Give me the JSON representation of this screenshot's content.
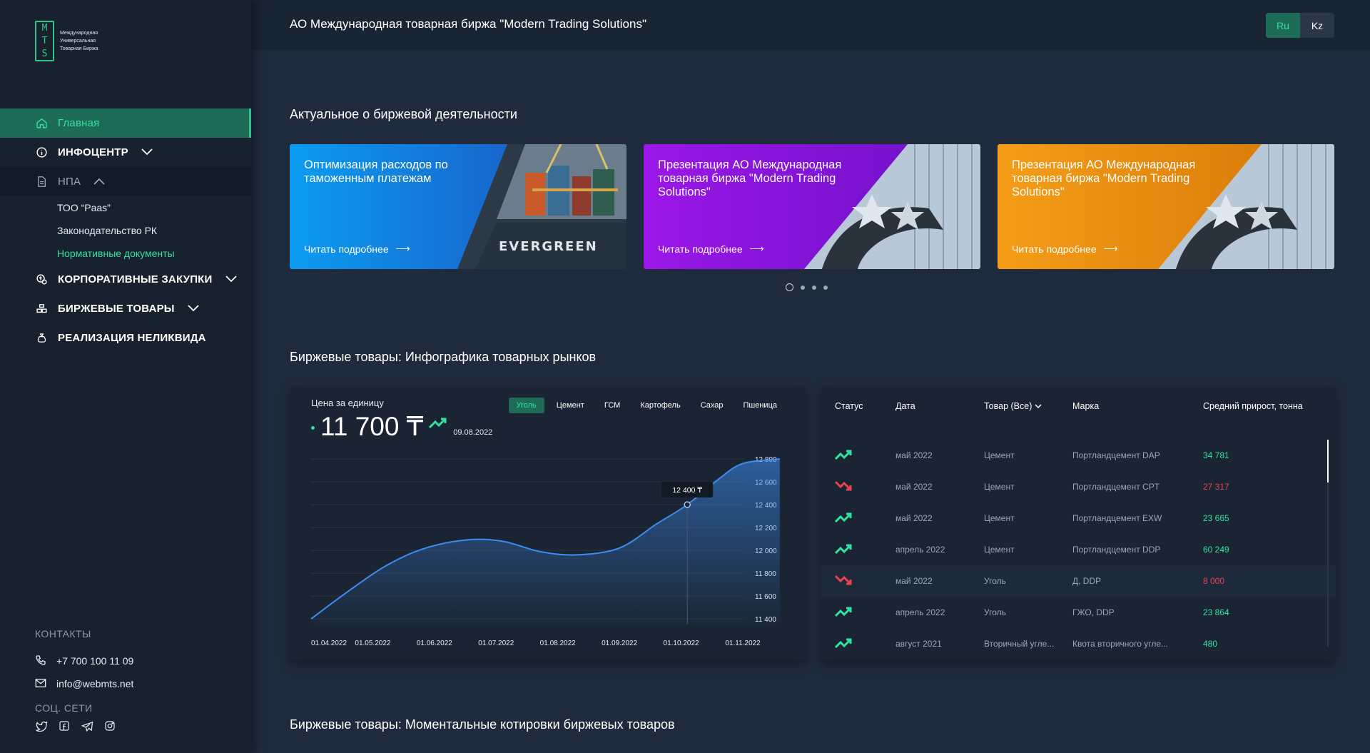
{
  "brand": {
    "logo_letters": [
      "M",
      "T",
      "S"
    ],
    "logo_lines": [
      "Международная",
      "Универсальная",
      "Товарная Биржа"
    ]
  },
  "header": {
    "title": "АО Международная товарная биржа \"Modern Trading Solutions\"",
    "lang": [
      "Ru",
      "Kz"
    ],
    "lang_active": "Ru"
  },
  "sidebar": {
    "items": [
      {
        "label": "Главная",
        "icon": "home-icon"
      },
      {
        "label": "ИНФОЦЕНТР",
        "icon": "info-icon"
      },
      {
        "label": "НПА",
        "icon": "document-icon"
      },
      {
        "label": "КОРПОРАТИВНЫЕ ЗАКУПКИ",
        "icon": "procurement-icon"
      },
      {
        "label": "БИРЖЕВЫЕ ТОВАРЫ",
        "icon": "goods-icon"
      },
      {
        "label": "РЕАЛИЗАЦИЯ НЕЛИКВИДА",
        "icon": "moneybag-icon"
      }
    ],
    "npa_sub": [
      "ТОО “Paas”",
      "Законодательство РК",
      "Нормативные документы"
    ],
    "contacts_title": "КОНТАКТЫ",
    "phone": "+7 700 100 11 09",
    "email": "info@webmts.net",
    "social_title": "СОЦ. СЕТИ",
    "socials": [
      "twitter-icon",
      "facebook-icon",
      "telegram-icon",
      "instagram-icon"
    ]
  },
  "news": {
    "section_title": "Актуальное о биржевой деятельности",
    "cards": [
      {
        "text": "Оптимизация расходов по таможенным платежам",
        "more": "Читать подробнее",
        "ship_label": "EVERGREEN",
        "color1": "#0b9cf0",
        "color2": "#1f49b8"
      },
      {
        "text": "Презентация АО Международная товарная биржа \"Modern Trading Solutions\"",
        "more": "Читать подробнее",
        "color1": "#9b17e8",
        "color2": "#5a0fb3"
      },
      {
        "text": "Презентация АО Международная товарная биржа \"Modern Trading Solutions\"",
        "more": "Читать подробнее",
        "color1": "#f59d18",
        "color2": "#c96b05"
      }
    ],
    "slides": 4,
    "current_slide": 1
  },
  "infographic": {
    "section_title": "Биржевые товары: Инфографика товарных рынков",
    "price_label": "Цена за единицу",
    "price_value": "11 700 ₸",
    "price_date": "09.08.2022",
    "tabs": [
      "Уголь",
      "Цемент",
      "ГСМ",
      "Картофель",
      "Сахар",
      "Пшеница"
    ],
    "active_tab": "Уголь"
  },
  "chart_data": {
    "type": "area",
    "x_labels": [
      "01.04.2022",
      "01.05.2022",
      "01.06.2022",
      "01.07.2022",
      "01.08.2022",
      "01.09.2022",
      "01.10.2022",
      "01.11.2022"
    ],
    "y_ticks": [
      "12 800",
      "12 600",
      "12 400",
      "12 200",
      "12 000",
      "11 800",
      "11 600",
      "11 400"
    ],
    "ylim": [
      11400,
      12800
    ],
    "x": [
      0,
      0.6,
      1.2,
      1.8,
      2.5,
      3.1,
      3.7,
      4.3,
      5.0,
      5.6,
      6.1,
      6.6,
      7.0,
      7.6
    ],
    "y": [
      11400,
      11640,
      11860,
      12010,
      12090,
      12080,
      11990,
      11960,
      12020,
      12230,
      12400,
      12620,
      12760,
      12800
    ],
    "tooltip": {
      "x": 6.1,
      "y": 12400,
      "label": "12 400 ₸"
    },
    "grid": true,
    "line_color": "#3d8cf0"
  },
  "table": {
    "headers": {
      "status": "Статус",
      "date": "Дата",
      "goods": "Товар (Все)",
      "brand": "Марка",
      "growth": "Средний прирост, тонна"
    },
    "rows": [
      {
        "trend": "up",
        "date": "май 2022",
        "goods": "Цемент",
        "brand": "Портландцемент DAP",
        "growth": "34 781"
      },
      {
        "trend": "down",
        "date": "май 2022",
        "goods": "Цемент",
        "brand": "Портландцемент CPT",
        "growth": "27 317"
      },
      {
        "trend": "up",
        "date": "май 2022",
        "goods": "Цемент",
        "brand": "Портландцемент EXW",
        "growth": "23 665"
      },
      {
        "trend": "up",
        "date": "апрель 2022",
        "goods": "Цемент",
        "brand": "Портландцемент DDP",
        "growth": "60 249"
      },
      {
        "trend": "down",
        "date": "май 2022",
        "goods": "Уголь",
        "brand": "Д, DDP",
        "growth": "8 000"
      },
      {
        "trend": "up",
        "date": "апрель 2022",
        "goods": "Уголь",
        "brand": "ГЖО, DDP",
        "growth": "23 864"
      },
      {
        "trend": "up",
        "date": "август 2021",
        "goods": "Вторичный угле...",
        "brand": "Квота вторичного угле...",
        "growth": "480"
      }
    ],
    "highlighted_row": 4
  },
  "quotes": {
    "section_title": "Биржевые товары: Моментальные котировки биржевых товаров"
  },
  "colors": {
    "accent": "#34e2a0",
    "accent_bg": "#1e6c58",
    "up": "#34e2a0",
    "down": "#e8434f",
    "bg": "#1f2b3c",
    "sidebar": "#18222f"
  }
}
